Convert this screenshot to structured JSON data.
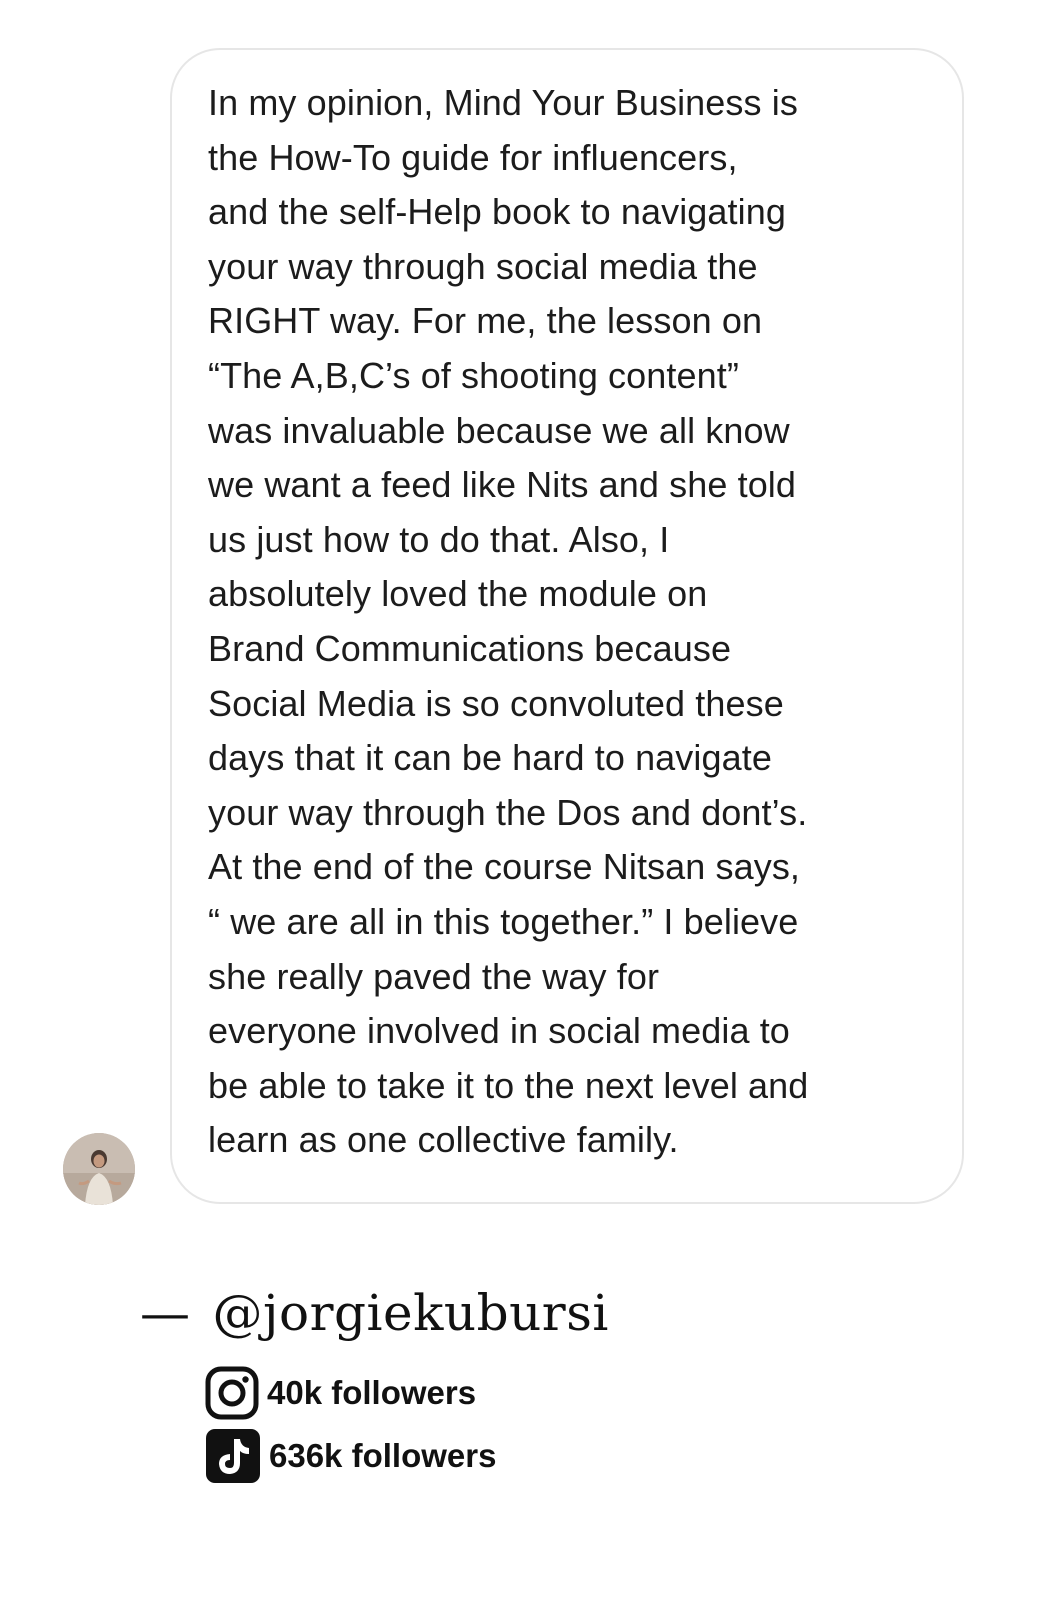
{
  "message": {
    "lines": [
      "In my opinion, Mind Your Business is",
      "the How-To guide for influencers,",
      "and the self-Help book to navigating",
      "your way through social media the",
      "RIGHT way. For me, the lesson on",
      "“The A,B,C’s of shooting content”",
      "was invaluable because we all know",
      "we want a feed like Nits and she told",
      "us just how to do that. Also, I",
      "absolutely loved the module on",
      "Brand Communications because",
      "Social Media is so convoluted these",
      "days that it can be hard to navigate",
      "your way through the Dos and dont’s.",
      "At the end of the course Nitsan says,",
      "“ we are all in this together.” I believe",
      "she really paved the way for",
      "everyone involved in social media to",
      "be able to take it to the next level and",
      "learn as one collective family."
    ]
  },
  "attribution": {
    "dash": "—",
    "handle": "@jorgiekubursi"
  },
  "stats": {
    "instagram": {
      "icon": "instagram-icon",
      "label": "40k followers"
    },
    "tiktok": {
      "icon": "tiktok-icon",
      "label": "636k followers"
    }
  },
  "colors": {
    "bubble_border": "#e6e6e6",
    "text": "#1c1c1c",
    "background": "#ffffff"
  }
}
